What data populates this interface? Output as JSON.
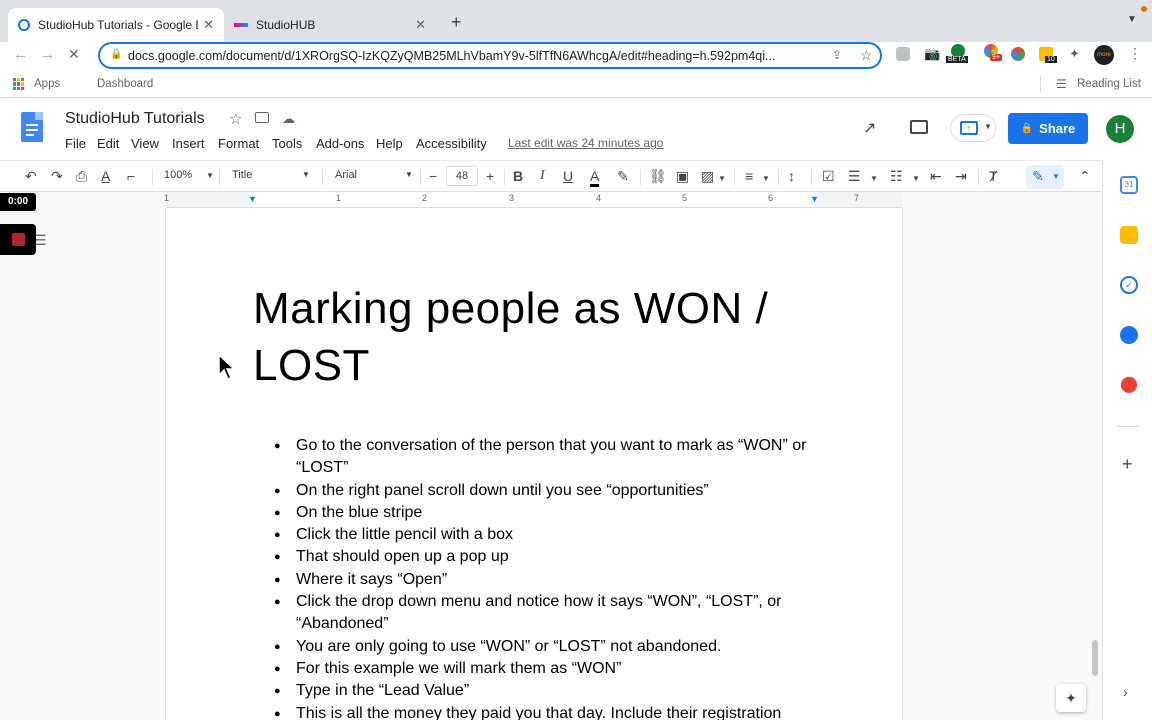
{
  "browser": {
    "tabs": [
      {
        "title": "StudioHub Tutorials - Google D",
        "active": true
      },
      {
        "title": "StudioHUB",
        "active": false
      }
    ],
    "new_tab": "+",
    "url": "docs.google.com/document/d/1XROrgSQ-IzKQZyQMB25MLhVbamY9v-5lfTfN6AWhcgA/edit#heading=h.592pm4qi...",
    "bookmarks": {
      "apps": "Apps",
      "dashboard": "Dashboard",
      "reading_list": "Reading List"
    },
    "ext_badges": {
      "beta": "BETA",
      "count": "9+",
      "ten": "10",
      "more": "more"
    }
  },
  "docs": {
    "title": "StudioHub Tutorials",
    "menu": [
      "File",
      "Edit",
      "View",
      "Insert",
      "Format",
      "Tools",
      "Add-ons",
      "Help",
      "Accessibility"
    ],
    "last_edit": "Last edit was 24 minutes ago",
    "share": "Share",
    "avatar": "H",
    "toolbar": {
      "zoom": "100%",
      "style": "Title",
      "font": "Arial",
      "size": "48"
    },
    "ruler_numbers": [
      "1",
      "1",
      "2",
      "3",
      "4",
      "5",
      "6",
      "7"
    ],
    "recorder_time": "0:00"
  },
  "document": {
    "heading": "Marking people as WON / LOST",
    "bullets": [
      "Go to the conversation of the person that you want to mark as “WON” or “LOST”",
      "On the right panel scroll down until you see “opportunities”",
      "On the blue stripe",
      "Click the little pencil with a box",
      "That should open up a pop up",
      "Where it says “Open”",
      "Click the drop down menu and notice how it says “WON”, “LOST”, or “Abandoned”",
      "You are only going to use “WON” or “LOST” not abandoned.",
      "For this example we will mark them as “WON”",
      "Type in the “Lead Value”",
      "This is all the money they paid you that day. Include their registration"
    ]
  },
  "colors": {
    "accent": "#1a73e8",
    "docs_blue": "#4285f4",
    "avatar_green": "#188038"
  }
}
